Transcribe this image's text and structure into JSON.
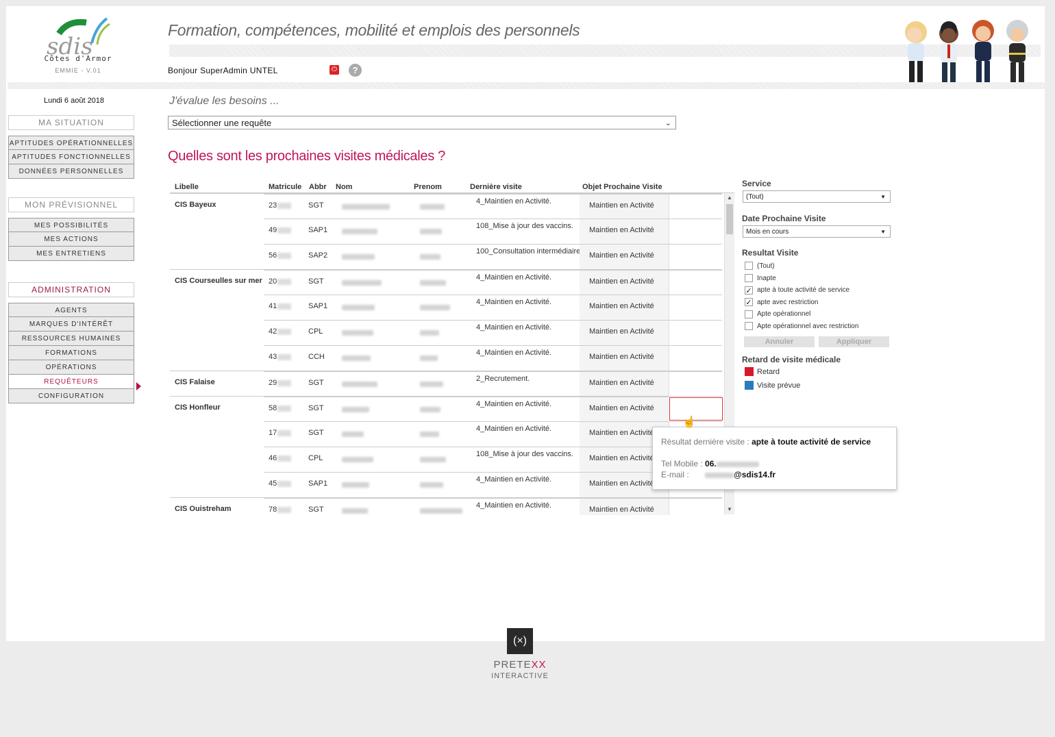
{
  "header": {
    "logo_text": "sdis",
    "logo_dept": "Côtes d'Armor",
    "version": "EMMIE - V.01",
    "app_title": "Formation, compétences, mobilité et emplois des personnels",
    "greeting": "Bonjour SuperAdmin UNTEL",
    "help_symbol": "?",
    "power_icon": "power-icon"
  },
  "sidebar": {
    "date": "Lundi 6 août 2018",
    "sections": [
      {
        "title": "MA SITUATION",
        "items": [
          "APTITUDES OPÉRATIONNELLES",
          "APTITUDES FONCTIONNELLES",
          "DONNÉES PERSONNELLES"
        ]
      },
      {
        "title": "MON PRÉVISIONNEL",
        "items": [
          "MES POSSIBILITÉS",
          "MES ACTIONS",
          "MES ENTRETIENS"
        ]
      },
      {
        "title": "ADMINISTRATION",
        "items": [
          "AGENTS",
          "MARQUES D'INTÉRÊT",
          "RESSOURCES HUMAINES",
          "FORMATIONS",
          "OPÉRATIONS",
          "REQUÊTEURS",
          "CONFIGURATION"
        ]
      }
    ],
    "active_item": "REQUÊTEURS"
  },
  "main": {
    "section_title": "J'évalue les besoins ...",
    "query_select": "Sélectionner une requête",
    "title": "Quelles sont les prochaines visites médicales ?",
    "columns": [
      "Libelle",
      "Matricule",
      "Abbr",
      "Nom",
      "Prenom",
      "Dernière visite",
      "Objet Prochaine Visite"
    ],
    "rows": [
      {
        "libelle": "CIS Bayeux",
        "mat": "23",
        "abbr": "SGT",
        "der": "4_Maintien en Activité.",
        "obj": "Maintien en Activité"
      },
      {
        "libelle": "",
        "mat": "49",
        "abbr": "SAP1",
        "der": "108_Mise à jour des vaccins.",
        "obj": "Maintien en Activité"
      },
      {
        "libelle": "",
        "mat": "56",
        "abbr": "SAP2",
        "der": "100_Consultation intermédiaire.",
        "obj": "Maintien en Activité"
      },
      {
        "libelle": "CIS Courseulles sur mer",
        "mat": "20",
        "abbr": "SGT",
        "der": "4_Maintien en Activité.",
        "obj": "Maintien en Activité"
      },
      {
        "libelle": "",
        "mat": "41",
        "abbr": "SAP1",
        "der": "4_Maintien en Activité.",
        "obj": "Maintien en Activité"
      },
      {
        "libelle": "",
        "mat": "42",
        "abbr": "CPL",
        "der": "4_Maintien en Activité.",
        "obj": "Maintien en Activité"
      },
      {
        "libelle": "",
        "mat": "43",
        "abbr": "CCH",
        "der": "4_Maintien en Activité.",
        "obj": "Maintien en Activité"
      },
      {
        "libelle": "CIS Falaise",
        "mat": "29",
        "abbr": "SGT",
        "der": "2_Recrutement.",
        "obj": "Maintien en Activité"
      },
      {
        "libelle": "CIS Honfleur",
        "mat": "58",
        "abbr": "SGT",
        "der": "4_Maintien en Activité.",
        "obj": "Maintien en Activité"
      },
      {
        "libelle": "",
        "mat": "17",
        "abbr": "SGT",
        "der": "4_Maintien en Activité.",
        "obj": "Maintien en Activité"
      },
      {
        "libelle": "",
        "mat": "46",
        "abbr": "CPL",
        "der": "108_Mise à jour des vaccins.",
        "obj": "Maintien en Activité"
      },
      {
        "libelle": "",
        "mat": "45",
        "abbr": "SAP1",
        "der": "4_Maintien en Activité.",
        "obj": "Maintien en Activité"
      },
      {
        "libelle": "CIS Ouistreham",
        "mat": "78",
        "abbr": "SGT",
        "der": "4_Maintien en Activité.",
        "obj": "Maintien en Activité"
      }
    ]
  },
  "filters": {
    "service_label": "Service",
    "service_value": "(Tout)",
    "date_label": "Date Prochaine Visite",
    "date_value": "Mois en cours",
    "resultat_label": "Resultat Visite",
    "resultat_options": [
      {
        "label": "(Tout)",
        "checked": false
      },
      {
        "label": "Inapte",
        "checked": false
      },
      {
        "label": "apte à toute activité de service",
        "checked": true
      },
      {
        "label": "apte avec restriction",
        "checked": true
      },
      {
        "label": "Apte opérationnel",
        "checked": false
      },
      {
        "label": "Apte opérationnel avec restriction",
        "checked": false
      }
    ],
    "cancel": "Annuler",
    "apply": "Appliquer",
    "retard_label": "Retard de visite médicale",
    "legend": [
      {
        "label": "Retard",
        "color": "#d7192b"
      },
      {
        "label": "Visite prévue",
        "color": "#2b7bbd"
      }
    ]
  },
  "tooltip": {
    "result_label": "Résultat dernière visite :",
    "result_value": "apte à toute activité de service",
    "tel_label": "Tel Mobile :",
    "tel_value": "06.",
    "email_label": "E-mail :",
    "email_value": "@sdis14.fr"
  },
  "footer": {
    "brand_a": "PRETE",
    "brand_b": "XX",
    "brand_sub": "INTERACTIVE"
  }
}
